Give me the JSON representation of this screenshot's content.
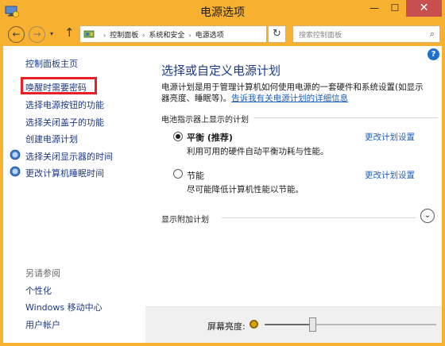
{
  "window": {
    "title": "电源选项",
    "min_glyph": "—",
    "max_glyph": "☐",
    "close_glyph": "✕"
  },
  "nav": {
    "back_glyph": "←",
    "forward_glyph": "→",
    "history_glyph": "▾",
    "up_glyph": "↑",
    "breadcrumbs": [
      "控制面板",
      "系统和安全",
      "电源选项"
    ],
    "crumb_sep": "›",
    "dropdown_glyph": "▾",
    "refresh_glyph": "↻",
    "search_placeholder": "搜索控制面板",
    "search_glyph": "⌕"
  },
  "sidebar": {
    "home": "控制面板主页",
    "items": [
      {
        "label": "唤醒时需要密码",
        "highlighted": true
      },
      {
        "label": "选择电源按钮的功能"
      },
      {
        "label": "选择关闭盖子的功能"
      },
      {
        "label": "创建电源计划"
      },
      {
        "label": "选择关闭显示器的时间",
        "icon": "shield-icon"
      },
      {
        "label": "更改计算机睡眠时间",
        "icon": "shield-icon"
      }
    ],
    "see_also_title": "另请参阅",
    "see_also": [
      "个性化",
      "Windows 移动中心",
      "用户帐户"
    ]
  },
  "main": {
    "help_glyph": "?",
    "title": "选择或自定义电源计划",
    "description": "电源计划是用于管理计算机如何使用电源的一套硬件和系统设置(如显示器亮度、睡眠等)。",
    "description_link": "告诉我有关电源计划的详细信息",
    "group_header": "电池指示器上显示的计划",
    "plans": [
      {
        "name": "平衡 (推荐)",
        "desc": "利用可用的硬件自动平衡功耗与性能。",
        "selected": true,
        "change": "更改计划设置"
      },
      {
        "name": "节能",
        "desc": "尽可能降低计算机性能以节能。",
        "selected": false,
        "change": "更改计划设置"
      }
    ],
    "more_plans": "显示附加计划",
    "expand_glyph": "⌄"
  },
  "footer": {
    "brightness_label": "屏幕亮度:",
    "brightness_level": 0.28
  },
  "colors": {
    "frame": "#f7b030",
    "close": "#c74f50",
    "link": "#1e3a86",
    "highlight": "#e81f27"
  }
}
